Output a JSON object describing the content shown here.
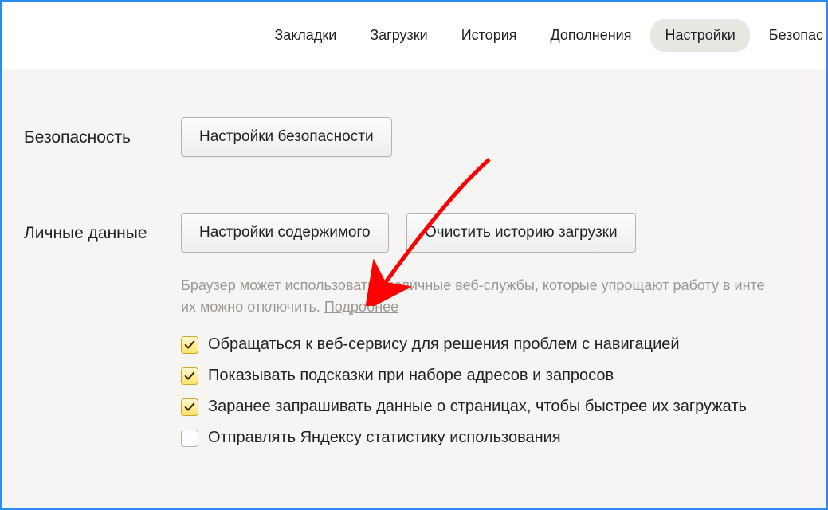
{
  "nav": {
    "items": [
      {
        "label": "Закладки",
        "active": false
      },
      {
        "label": "Загрузки",
        "active": false
      },
      {
        "label": "История",
        "active": false
      },
      {
        "label": "Дополнения",
        "active": false
      },
      {
        "label": "Настройки",
        "active": true
      },
      {
        "label": "Безопас",
        "active": false
      }
    ]
  },
  "sections": {
    "security": {
      "label": "Безопасность",
      "button": "Настройки безопасности"
    },
    "personal": {
      "label": "Личные данные",
      "buttons": {
        "content": "Настройки содержимого",
        "clear": "Очистить историю загрузки"
      },
      "help": {
        "text_a": "Браузер может использовать различные веб-службы, которые упрощают работу в инте",
        "text_b": "их можно отключить. ",
        "more": "Подробнее"
      },
      "checks": [
        {
          "label": "Обращаться к веб-сервису для решения проблем с навигацией",
          "checked": true
        },
        {
          "label": "Показывать подсказки при наборе адресов и запросов",
          "checked": true
        },
        {
          "label": "Заранее запрашивать данные о страницах, чтобы быстрее их загружать",
          "checked": true
        },
        {
          "label": "Отправлять Яндексу статистику использования",
          "checked": false
        }
      ]
    }
  }
}
